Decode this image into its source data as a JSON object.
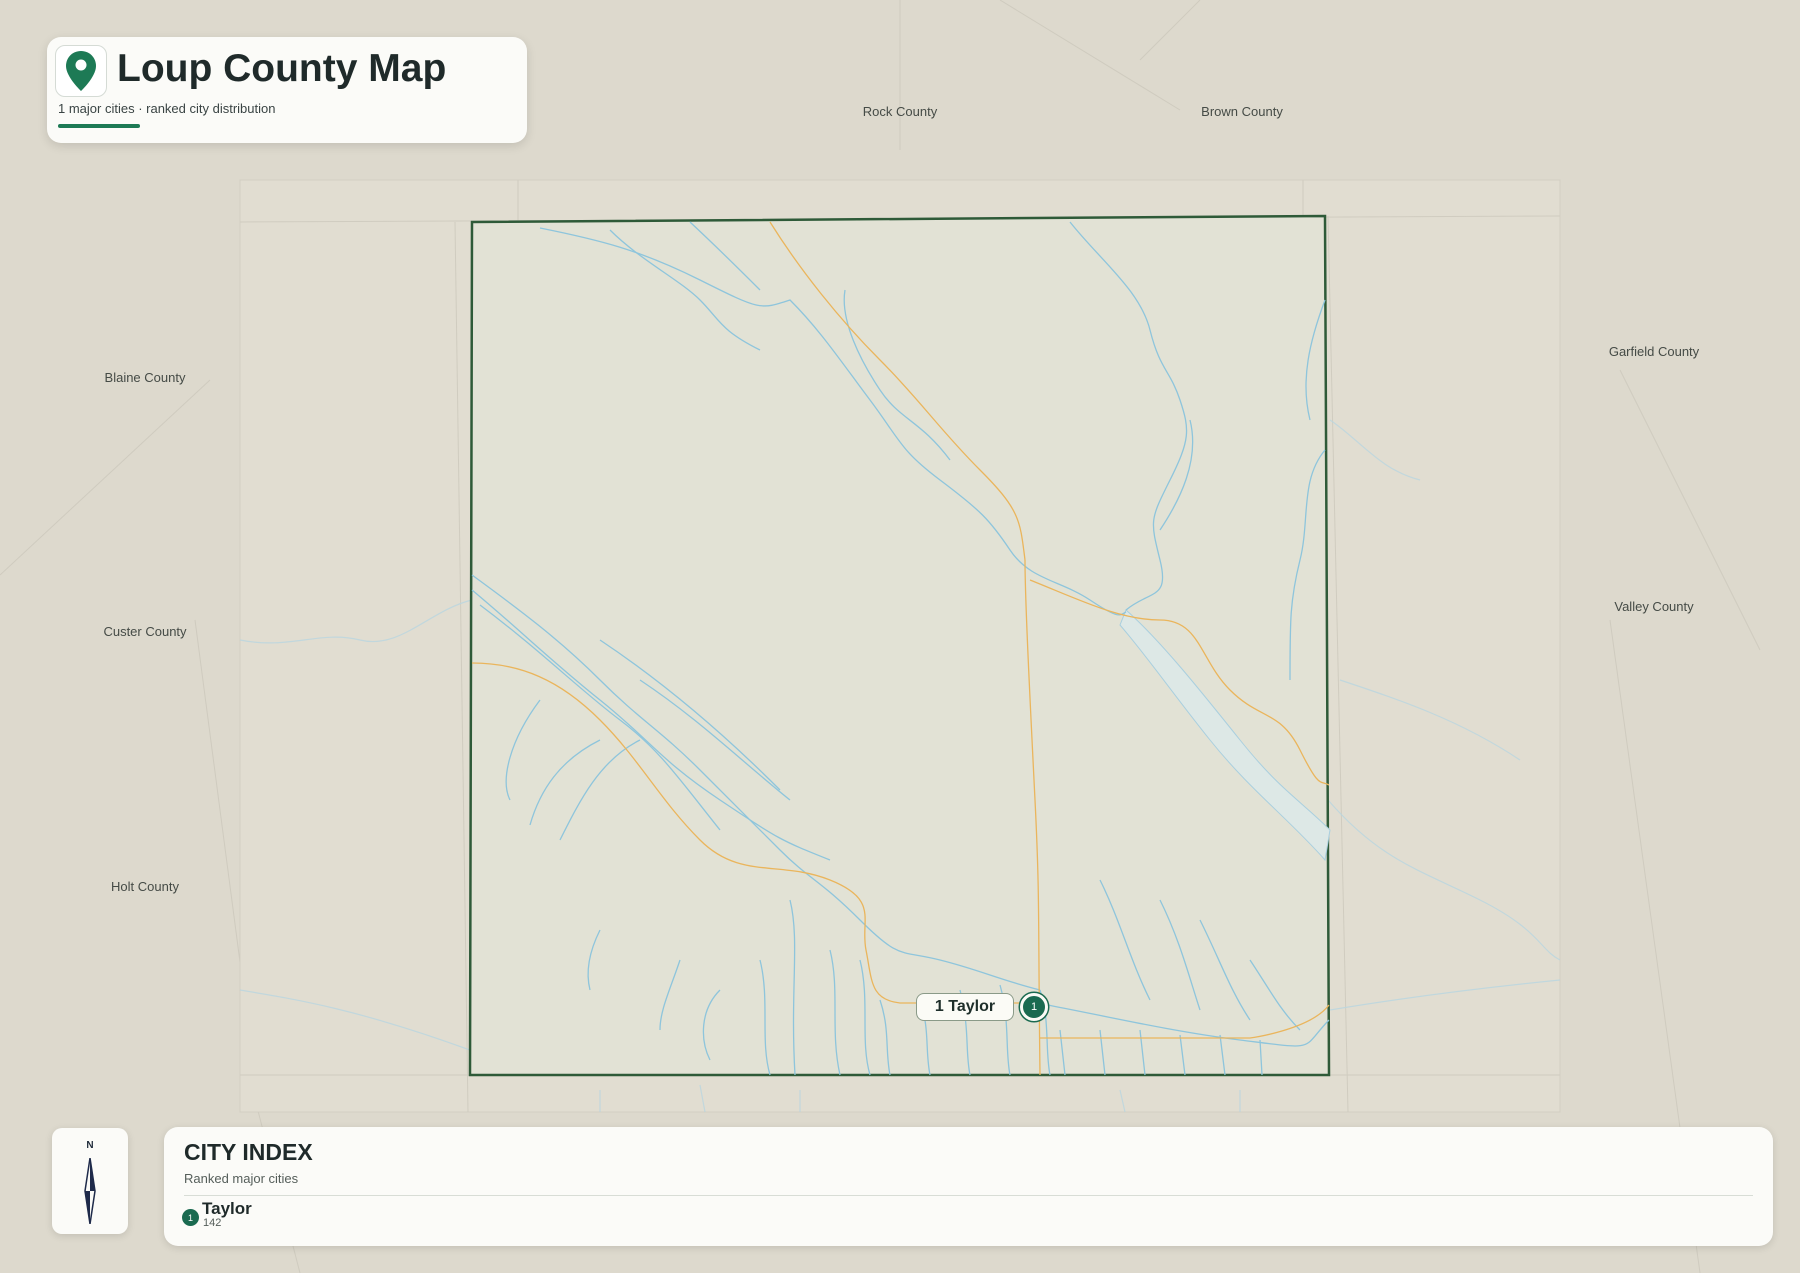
{
  "header": {
    "title": "Loup County Map",
    "subtitle": "1 major cities · ranked city distribution"
  },
  "neighbor_counties": [
    {
      "name": "Rock County"
    },
    {
      "name": "Brown County"
    },
    {
      "name": "Blaine County"
    },
    {
      "name": "Garfield County"
    },
    {
      "name": "Custer County"
    },
    {
      "name": "Valley County"
    },
    {
      "name": "Holt County"
    }
  ],
  "map": {
    "county_name": "Loup County",
    "city_marker": {
      "rank": "1",
      "label": "1 Taylor",
      "name": "Taylor"
    }
  },
  "compass": {
    "north_label": "N"
  },
  "city_index": {
    "title": "CITY INDEX",
    "subtitle": "Ranked major cities",
    "cities": [
      {
        "rank": "1",
        "name": "Taylor",
        "value": "142"
      }
    ]
  },
  "colors": {
    "background": "#ddd9cd",
    "county_fill": "#e2e2d5",
    "county_border": "#2e5a38",
    "rivers": "#8ec5dc",
    "roads": "#eab55c",
    "accent": "#1a6a50"
  }
}
